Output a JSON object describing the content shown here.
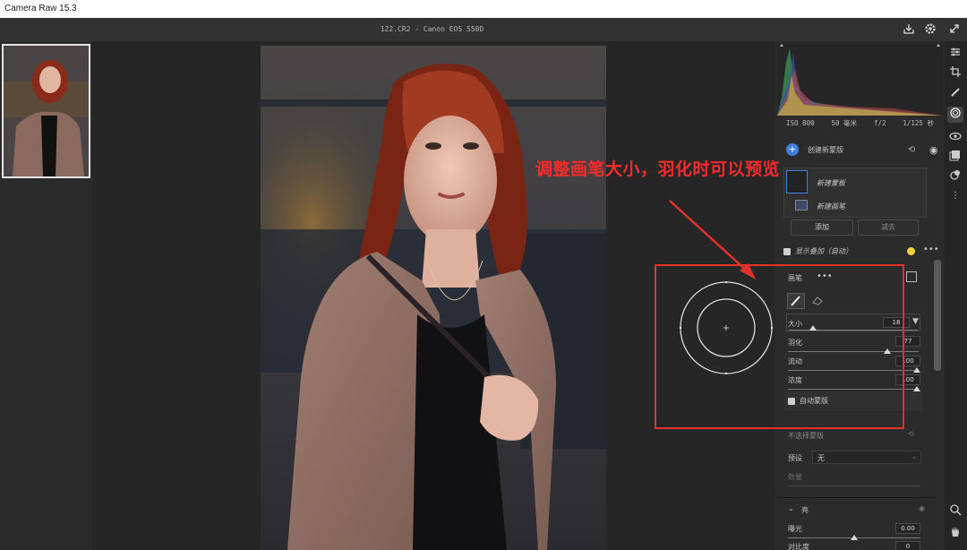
{
  "app": {
    "title": "Camera Raw 15.3"
  },
  "file": {
    "info": "122.CR2  -  Canon EOS 550D"
  },
  "exif": {
    "iso": "ISO 800",
    "focal": "50 毫米",
    "aperture": "f/2",
    "shutter": "1/125 秒"
  },
  "annotation": {
    "text": "调整画笔大小，羽化时可以预览",
    "color": "#ff2a2a"
  },
  "masks": {
    "create_label": "创建新蒙版",
    "mask_item": "新建蒙板",
    "brush_item": "新建画笔",
    "add_button": "添加",
    "subtract_button": "减去"
  },
  "overlay": {
    "label": "显示叠加（自动）"
  },
  "brush": {
    "title": "画笔",
    "more": "•••",
    "size_label": "大小",
    "size_value": "18",
    "size_level": 0.18,
    "feather_label": "羽化",
    "feather_value": "77",
    "feather_level": 0.77,
    "flow_label": "流动",
    "flow_value": "100",
    "flow_level": 1.0,
    "density_label": "浓度",
    "density_value": "100",
    "density_level": 1.0,
    "automask_label": "自动蒙版"
  },
  "range_mask": {
    "label": "不选择蒙版",
    "preset_label": "预设",
    "preset_value": "无",
    "amount_label": "数量"
  },
  "light": {
    "section": "亮",
    "exposure_label": "曝光",
    "exposure_value": "0.00",
    "contrast_label": "对比度",
    "contrast_value": "0"
  },
  "colors": {
    "accent": "#3f7fe0",
    "redbox": "#e3322b",
    "overlay_dot": "#f0d23a"
  },
  "icons": [
    "save-icon",
    "gear-icon",
    "fullscreen-icon",
    "edit-icon",
    "crop-icon",
    "heal-icon",
    "mask-icon",
    "redeye-icon",
    "snapshots-icon",
    "presets-icon",
    "more-icon",
    "zoom-icon",
    "hand-icon"
  ]
}
